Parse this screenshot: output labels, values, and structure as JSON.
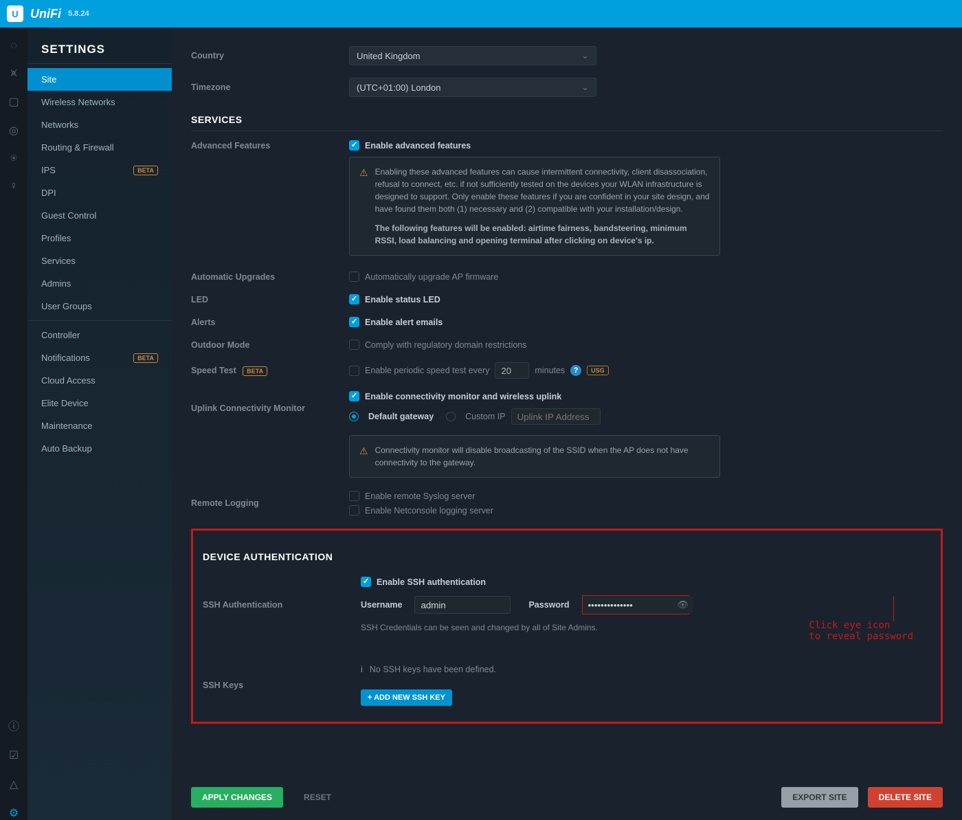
{
  "header": {
    "brand": "UniFi",
    "version": "5.8.24"
  },
  "sidebar_title": "SETTINGS",
  "nav": [
    {
      "label": "Site",
      "active": true
    },
    {
      "label": "Wireless Networks"
    },
    {
      "label": "Networks"
    },
    {
      "label": "Routing & Firewall"
    },
    {
      "label": "IPS",
      "beta": true
    },
    {
      "label": "DPI"
    },
    {
      "label": "Guest Control"
    },
    {
      "label": "Profiles"
    },
    {
      "label": "Services"
    },
    {
      "label": "Admins"
    },
    {
      "label": "User Groups"
    },
    {
      "divider": true
    },
    {
      "label": "Controller"
    },
    {
      "label": "Notifications",
      "beta": true
    },
    {
      "label": "Cloud Access"
    },
    {
      "label": "Elite Device"
    },
    {
      "label": "Maintenance"
    },
    {
      "label": "Auto Backup"
    }
  ],
  "country": {
    "label": "Country",
    "value": "United Kingdom"
  },
  "timezone": {
    "label": "Timezone",
    "value": "(UTC+01:00) London"
  },
  "sections": {
    "services": "SERVICES",
    "device_auth": "DEVICE AUTHENTICATION"
  },
  "adv": {
    "label": "Advanced Features",
    "cb": "Enable advanced features",
    "warn1": "Enabling these advanced features can cause intermittent connectivity, client disassociation, refusal to connect, etc. if not sufficiently tested on the devices your WLAN infrastructure is designed to support. Only enable these features if you are confident in your site design, and have found them both (1) necessary and (2) compatible with your installation/design.",
    "warn2": "The following features will be enabled: airtime fairness, bandsteering, minimum RSSI, load balancing and opening terminal after clicking on device's ip."
  },
  "auto_upgrade": {
    "label": "Automatic Upgrades",
    "cb": "Automatically upgrade AP firmware"
  },
  "led": {
    "label": "LED",
    "cb": "Enable status LED"
  },
  "alerts": {
    "label": "Alerts",
    "cb": "Enable alert emails"
  },
  "outdoor": {
    "label": "Outdoor Mode",
    "cb": "Comply with regulatory domain restrictions"
  },
  "speed": {
    "label": "Speed Test",
    "beta": "BETA",
    "cb": "Enable periodic speed test every",
    "value": "20",
    "unit": "minutes",
    "usg": "USG"
  },
  "uplink": {
    "label": "Uplink Connectivity Monitor",
    "cb": "Enable connectivity monitor and wireless uplink",
    "r1": "Default gateway",
    "r2": "Custom IP",
    "ph": "Uplink IP Address",
    "warn": "Connectivity monitor will disable broadcasting of the SSID when the AP does not have connectivity to the gateway."
  },
  "remote": {
    "label": "Remote Logging",
    "cb1": "Enable remote Syslog server",
    "cb2": "Enable Netconsole logging server"
  },
  "ssh": {
    "label": "SSH Authentication",
    "cb": "Enable SSH authentication",
    "user_label": "Username",
    "user_value": "admin",
    "pw_label": "Password",
    "pw_value": "••••••••••••••",
    "hint": "SSH Credentials can be seen and changed by all of Site Admins."
  },
  "sshkeys": {
    "label": "SSH Keys",
    "none": "No SSH keys have been defined.",
    "add": "+  ADD NEW SSH KEY"
  },
  "annotation": {
    "line1": "Click eye icon",
    "line2": "to reveal password"
  },
  "footer": {
    "apply": "APPLY CHANGES",
    "reset": "RESET",
    "export": "EXPORT SITE",
    "delete": "DELETE SITE"
  }
}
